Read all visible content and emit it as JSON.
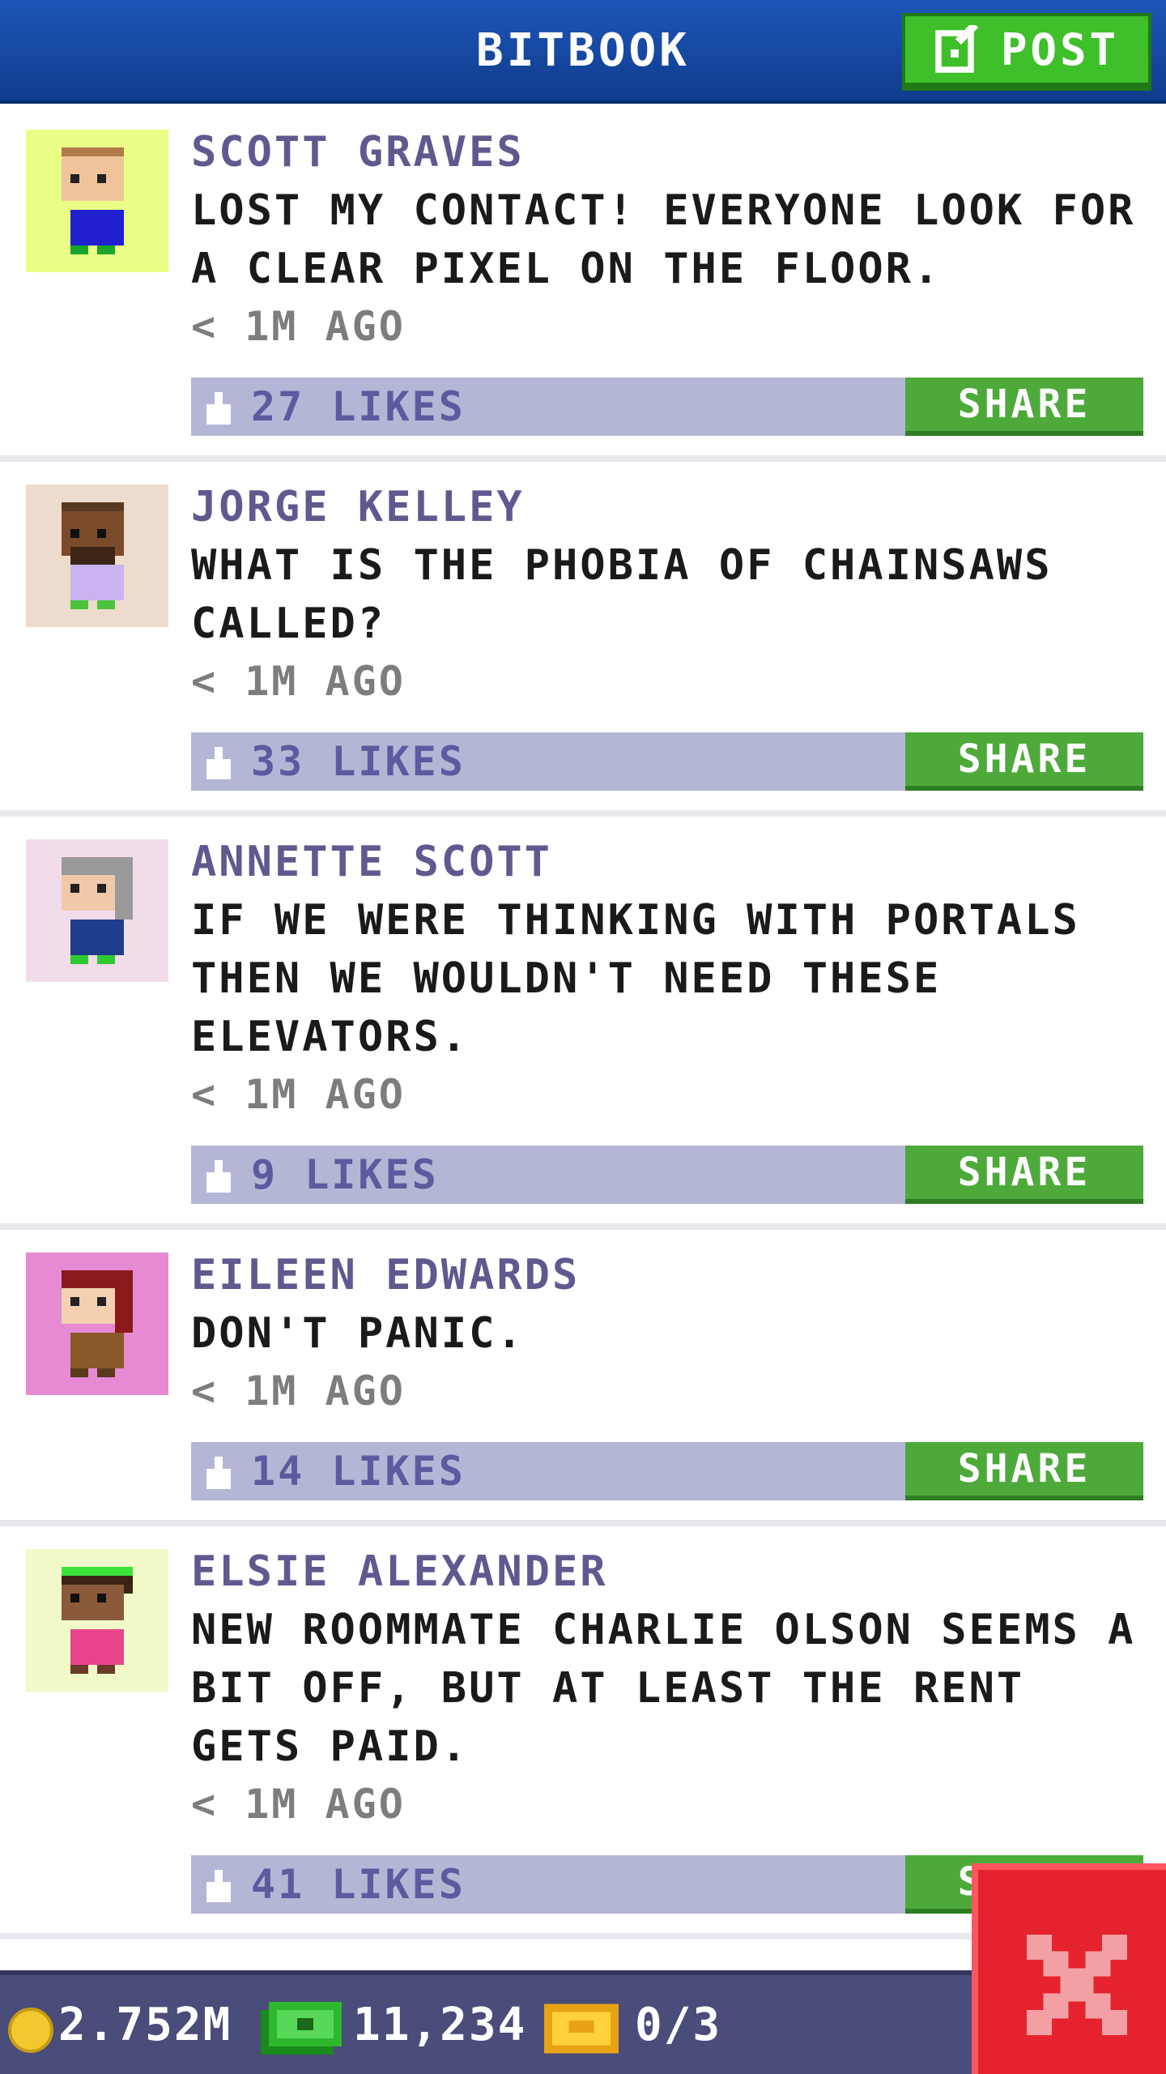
{
  "header": {
    "title": "BITBOOK",
    "post_label": "POST"
  },
  "posts": [
    {
      "author": "SCOTT GRAVES",
      "text": "LOST MY CONTACT! EVERYONE LOOK FOR A CLEAR PIXEL ON THE FLOOR.",
      "time": "< 1M AGO",
      "likes": "27 LIKES",
      "share_label": "SHARE",
      "avatar_bg": "#e9ff85"
    },
    {
      "author": "JORGE KELLEY",
      "text": "WHAT IS THE PHOBIA OF CHAINSAWS CALLED?",
      "time": "< 1M AGO",
      "likes": "33 LIKES",
      "share_label": "SHARE",
      "avatar_bg": "#eddccd"
    },
    {
      "author": "ANNETTE SCOTT",
      "text": "IF WE WERE THINKING WITH PORTALS THEN WE WOULDN'T NEED THESE ELEVATORS.",
      "time": "< 1M AGO",
      "likes": "9 LIKES",
      "share_label": "SHARE",
      "avatar_bg": "#f3dcea"
    },
    {
      "author": "EILEEN EDWARDS",
      "text": "DON'T PANIC.",
      "time": "< 1M AGO",
      "likes": "14 LIKES",
      "share_label": "SHARE",
      "avatar_bg": "#e68ad4"
    },
    {
      "author": "ELSIE ALEXANDER",
      "text": "NEW ROOMMATE CHARLIE OLSON SEEMS A BIT OFF, BUT AT LEAST THE RENT GETS PAID.",
      "time": "< 1M AGO",
      "likes": "41 LIKES",
      "share_label": "SHARE",
      "avatar_bg": "#f2f9c9"
    }
  ],
  "footer": {
    "coins": "2.752M",
    "bux": "11,234",
    "tickets": "0/3"
  },
  "colors": {
    "header": "#1e56b8",
    "accent_green": "#4daa3a",
    "like_bar": "#b4b6d6",
    "close_red": "#e4232e"
  }
}
